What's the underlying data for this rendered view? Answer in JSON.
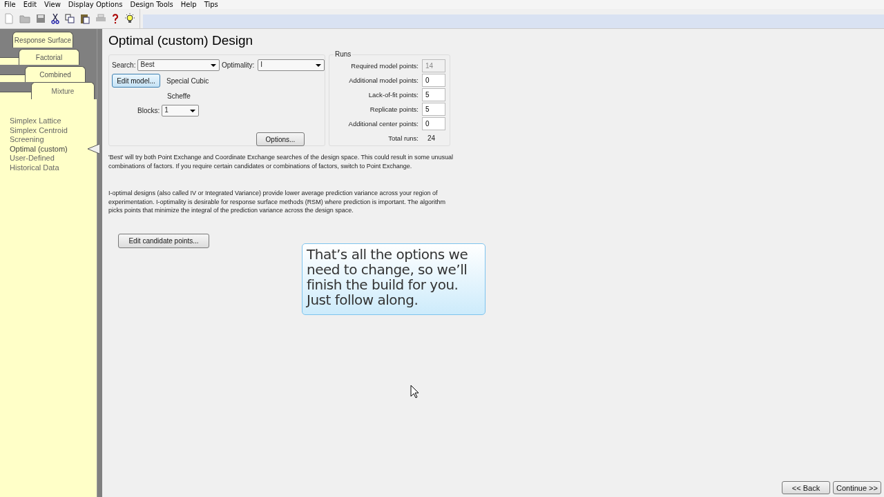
{
  "menu": [
    "File",
    "Edit",
    "View",
    "Display Options",
    "Design Tools",
    "Help",
    "Tips"
  ],
  "design_tabs": [
    {
      "label": "Response Surface",
      "selected": false
    },
    {
      "label": "Factorial",
      "selected": false
    },
    {
      "label": "Combined",
      "selected": false
    },
    {
      "label": "Mixture",
      "selected": true
    }
  ],
  "design_types": [
    {
      "label": "Simplex Lattice",
      "selected": false
    },
    {
      "label": "Simplex Centroid",
      "selected": false
    },
    {
      "label": "Screening",
      "selected": false
    },
    {
      "label": "Optimal (custom)",
      "selected": true
    },
    {
      "label": "User-Defined",
      "selected": false
    },
    {
      "label": "Historical Data",
      "selected": false
    }
  ],
  "title": "Optimal (custom) Design",
  "search": {
    "label": "Search:",
    "value": "Best"
  },
  "optimality": {
    "label": "Optimality:",
    "value": "I"
  },
  "edit_model_button": "Edit model...",
  "model_lines": [
    "Special Cubic",
    "Scheffe"
  ],
  "blocks": {
    "label": "Blocks:",
    "value": "1"
  },
  "options_button": "Options...",
  "runs": {
    "title": "Runs",
    "fields": [
      {
        "label": "Required model points:",
        "value": "14",
        "disabled": true
      },
      {
        "label": "Additional model points:",
        "value": "0",
        "disabled": false
      },
      {
        "label": "Lack-of-fit points:",
        "value": "5",
        "disabled": false
      },
      {
        "label": "Replicate points:",
        "value": "5",
        "disabled": false
      },
      {
        "label": "Additional center points:",
        "value": "0",
        "disabled": false
      }
    ],
    "total_label": "Total runs:",
    "total_value": "24"
  },
  "notes": [
    "'Best' will try both Point Exchange and Coordinate Exchange searches of the design space. This could result in some unusual combinations of factors. If you require certain candidates or combinations of factors, switch to Point Exchange.",
    "I-optimal designs (also called IV or Integrated Variance) provide lower average prediction variance across your region of experimentation.  I-optimality is desirable for response surface methods (RSM) where prediction is important.  The algorithm picks points that minimize the integral of the prediction variance across the design space."
  ],
  "edit_candidates_button": "Edit candidate points...",
  "callout": "That’s all the options we need to change, so we’ll finish the build for you. Just follow along.",
  "nav_buttons": [
    "<< Back",
    "Continue >>"
  ]
}
